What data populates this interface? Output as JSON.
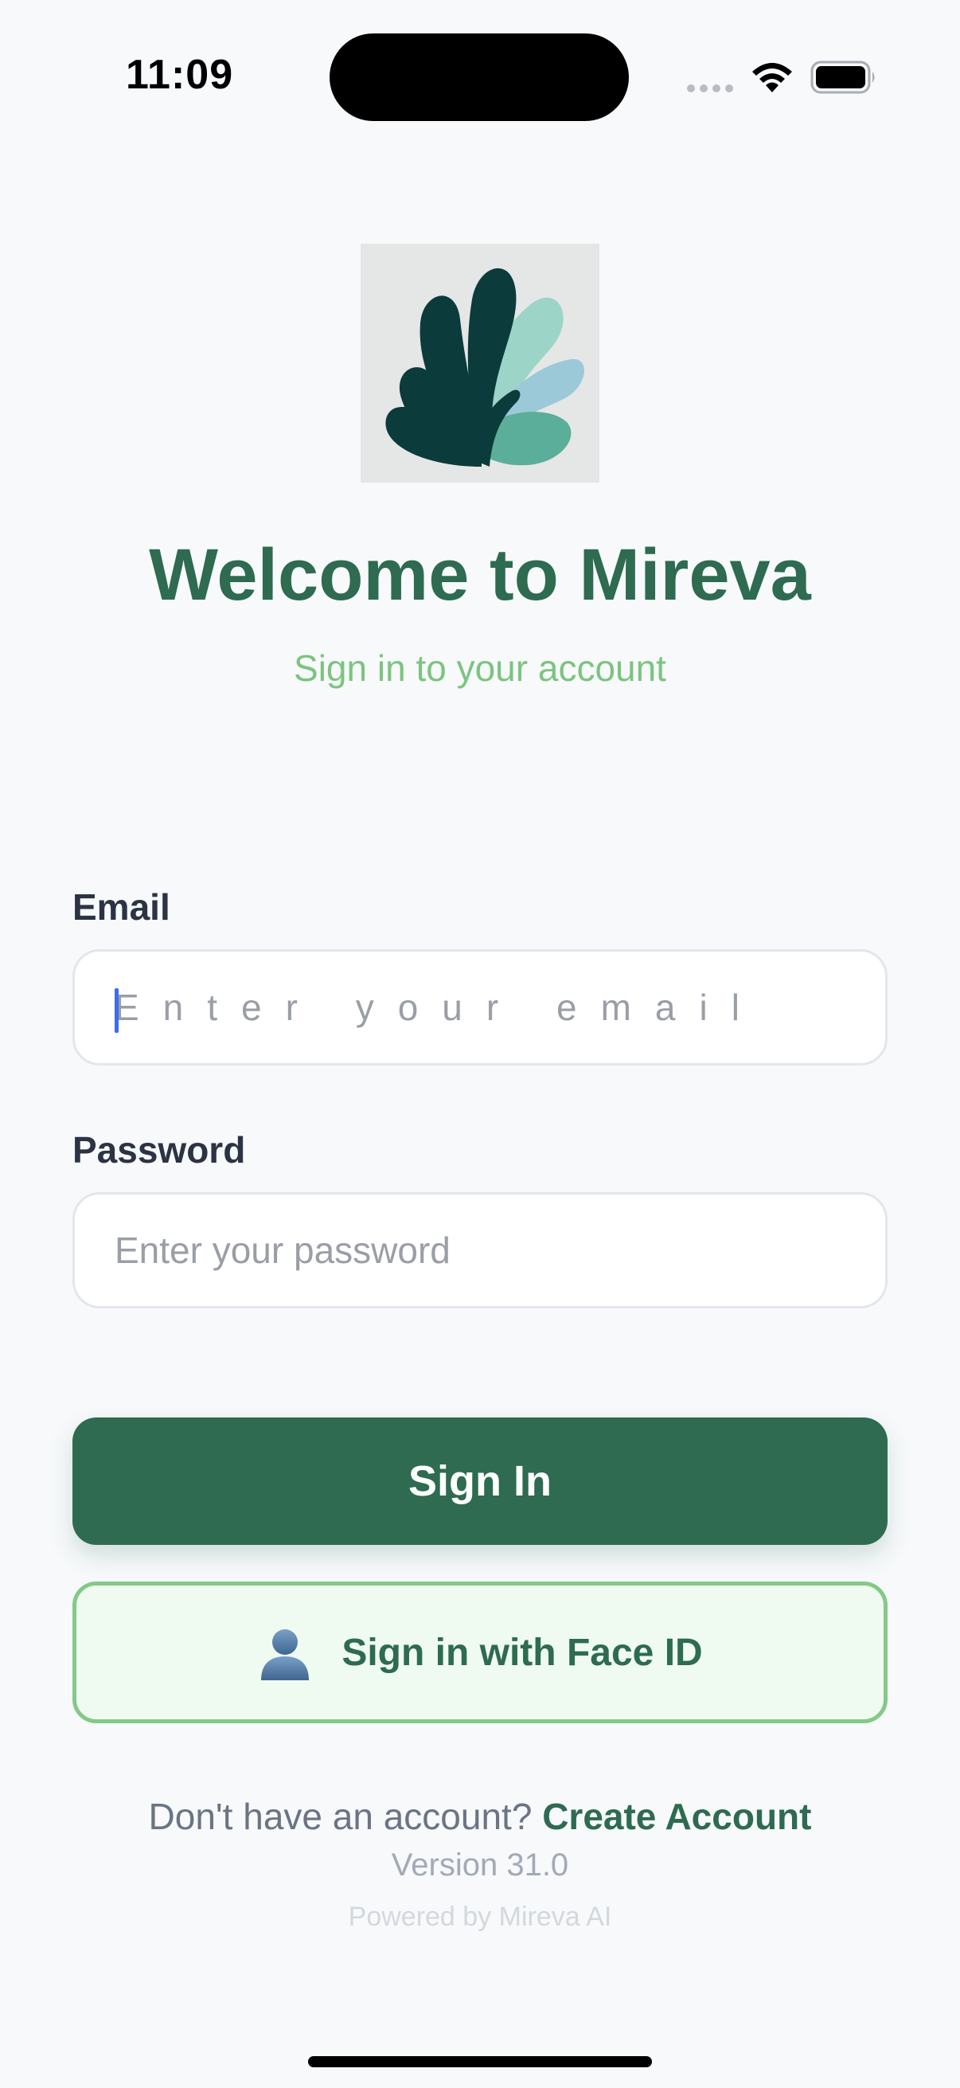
{
  "status_bar": {
    "time": "11:09",
    "icons": [
      "cellular-signal-icon",
      "wifi-icon",
      "battery-icon"
    ]
  },
  "logo": {
    "icon": "mireva-leaf-logo",
    "colors": {
      "dark": "#0b3b3a",
      "light_teal": "#9dd4c8",
      "light_blue": "#9cc9d8",
      "mid_teal": "#5aae9a",
      "background": "#e5e6e6"
    }
  },
  "header": {
    "title": "Welcome to Mireva",
    "subtitle": "Sign in to your account"
  },
  "form": {
    "email": {
      "label": "Email",
      "value": "",
      "placeholder": "Enter your email"
    },
    "password": {
      "label": "Password",
      "value": "",
      "placeholder": "Enter your password"
    }
  },
  "actions": {
    "sign_in_label": "Sign In",
    "face_id_label": "Sign in with Face ID",
    "face_id_icon": "person-silhouette-icon"
  },
  "footer": {
    "signup_prompt": "Don't have an account?",
    "create_account_label": "Create Account",
    "version": "Version 31.0",
    "powered_by": "Powered by Mireva AI"
  },
  "colors": {
    "primary": "#2e6b50",
    "accent_green": "#7cc47f",
    "face_id_bg": "#effbf1",
    "face_id_border": "#84c987",
    "background": "#f7f9fb"
  }
}
